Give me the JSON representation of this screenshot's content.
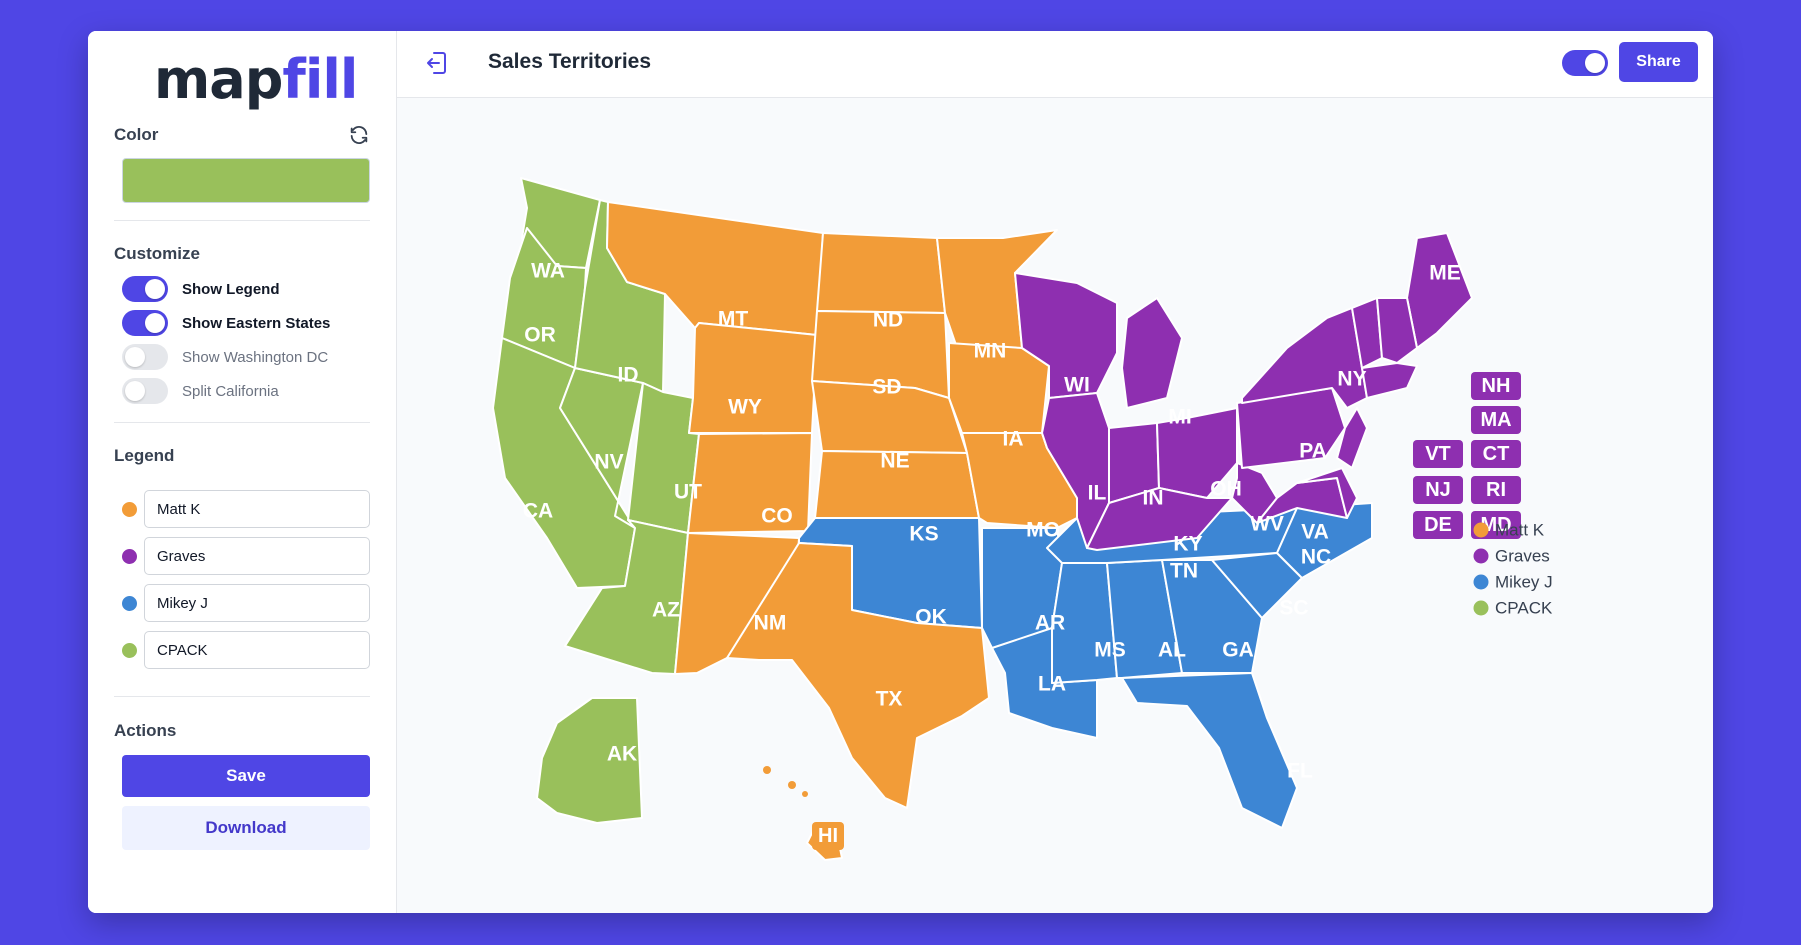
{
  "app": {
    "logo_map": "map",
    "logo_fill": "fill"
  },
  "sidebar": {
    "color_title": "Color",
    "color_value": "#99c05b",
    "customize_title": "Customize",
    "toggles": [
      {
        "label": "Show Legend",
        "on": true
      },
      {
        "label": "Show Eastern States",
        "on": true
      },
      {
        "label": "Show Washington DC",
        "on": false
      },
      {
        "label": "Split California",
        "on": false
      }
    ],
    "legend_title": "Legend",
    "legend": [
      {
        "name": "Matt K",
        "color": "#f29c38"
      },
      {
        "name": "Graves",
        "color": "#8e2fb0"
      },
      {
        "name": "Mikey J",
        "color": "#3d86d4"
      },
      {
        "name": "CPACK",
        "color": "#99c05b"
      }
    ],
    "actions_title": "Actions",
    "save_label": "Save",
    "download_label": "Download"
  },
  "header": {
    "title": "Sales Territories",
    "share_label": "Share",
    "toggle_on": true
  },
  "map": {
    "states": [
      {
        "code": "WA",
        "group": "CPACK"
      },
      {
        "code": "OR",
        "group": "CPACK"
      },
      {
        "code": "CA",
        "group": "CPACK"
      },
      {
        "code": "NV",
        "group": "CPACK"
      },
      {
        "code": "ID",
        "group": "CPACK"
      },
      {
        "code": "UT",
        "group": "CPACK"
      },
      {
        "code": "AZ",
        "group": "CPACK"
      },
      {
        "code": "AK",
        "group": "CPACK"
      },
      {
        "code": "MT",
        "group": "Matt K"
      },
      {
        "code": "WY",
        "group": "Matt K"
      },
      {
        "code": "CO",
        "group": "Matt K"
      },
      {
        "code": "NM",
        "group": "Matt K"
      },
      {
        "code": "ND",
        "group": "Matt K"
      },
      {
        "code": "SD",
        "group": "Matt K"
      },
      {
        "code": "NE",
        "group": "Matt K"
      },
      {
        "code": "KS",
        "group": "Matt K"
      },
      {
        "code": "TX",
        "group": "Matt K"
      },
      {
        "code": "MN",
        "group": "Matt K"
      },
      {
        "code": "IA",
        "group": "Matt K"
      },
      {
        "code": "MO",
        "group": "Matt K"
      },
      {
        "code": "HI",
        "group": "Matt K"
      },
      {
        "code": "OK",
        "group": "Mikey J"
      },
      {
        "code": "AR",
        "group": "Mikey J"
      },
      {
        "code": "LA",
        "group": "Mikey J"
      },
      {
        "code": "MS",
        "group": "Mikey J"
      },
      {
        "code": "AL",
        "group": "Mikey J"
      },
      {
        "code": "GA",
        "group": "Mikey J"
      },
      {
        "code": "FL",
        "group": "Mikey J"
      },
      {
        "code": "TN",
        "group": "Mikey J"
      },
      {
        "code": "SC",
        "group": "Mikey J"
      },
      {
        "code": "NC",
        "group": "Mikey J"
      },
      {
        "code": "WI",
        "group": "Graves"
      },
      {
        "code": "IL",
        "group": "Graves"
      },
      {
        "code": "MI",
        "group": "Graves"
      },
      {
        "code": "IN",
        "group": "Graves"
      },
      {
        "code": "OH",
        "group": "Graves"
      },
      {
        "code": "KY",
        "group": "Graves"
      },
      {
        "code": "WV",
        "group": "Graves"
      },
      {
        "code": "VA",
        "group": "Graves"
      },
      {
        "code": "PA",
        "group": "Graves"
      },
      {
        "code": "NY",
        "group": "Graves"
      },
      {
        "code": "ME",
        "group": "Graves"
      },
      {
        "code": "NH",
        "group": "Graves"
      },
      {
        "code": "MA",
        "group": "Graves"
      },
      {
        "code": "VT",
        "group": "Graves"
      },
      {
        "code": "CT",
        "group": "Graves"
      },
      {
        "code": "NJ",
        "group": "Graves"
      },
      {
        "code": "RI",
        "group": "Graves"
      },
      {
        "code": "DE",
        "group": "Graves"
      },
      {
        "code": "MD",
        "group": "Graves"
      }
    ],
    "legend": [
      {
        "name": "Matt K",
        "color": "#f29c38"
      },
      {
        "name": "Graves",
        "color": "#8e2fb0"
      },
      {
        "name": "Mikey J",
        "color": "#3d86d4"
      },
      {
        "name": "CPACK",
        "color": "#99c05b"
      }
    ]
  }
}
